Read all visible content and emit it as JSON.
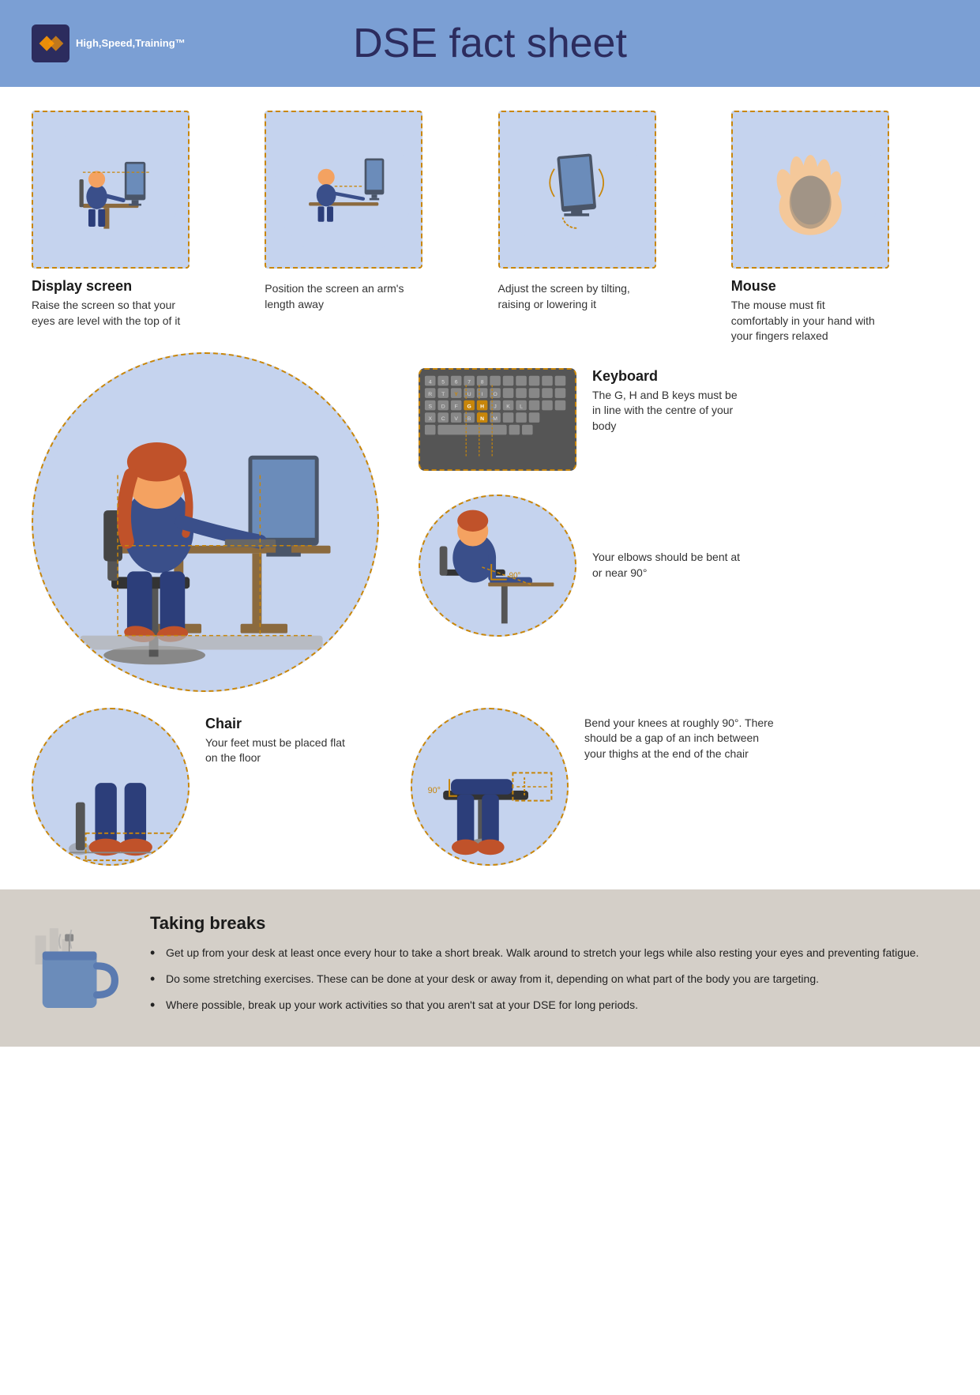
{
  "header": {
    "logo_lines": [
      "High",
      "Speed",
      "Training™"
    ],
    "title": "DSE fact sheet"
  },
  "display_screen": {
    "title": "Display screen",
    "desc": "Raise the screen so that your eyes are level with the top of it"
  },
  "position_screen": {
    "title": "",
    "desc": "Position the screen an arm's length away"
  },
  "adjust_screen": {
    "title": "",
    "desc": "Adjust the screen by tilting, raising or lowering it"
  },
  "mouse": {
    "title": "Mouse",
    "desc": "The mouse must fit comfortably in your hand with your fingers relaxed"
  },
  "keyboard": {
    "title": "Keyboard",
    "desc": "The G, H and B keys must be in line with the centre of your body"
  },
  "elbow": {
    "desc": "Your elbows should be bent at or near 90°"
  },
  "chair": {
    "title": "Chair",
    "desc": "Your feet must be placed flat on the floor"
  },
  "knee": {
    "desc": "Bend your knees at roughly 90°. There should be a gap of an inch between your thighs at the end of the chair"
  },
  "breaks": {
    "title": "Taking breaks",
    "items": [
      "Get up from your desk at least once every hour to take a short break. Walk around to stretch your legs while also resting your eyes and preventing fatigue.",
      "Do some stretching exercises. These can be done at your desk or away from it, depending on what part of the body you are targeting.",
      "Where possible, break up your work activities so that you aren't sat at your DSE for long periods."
    ]
  }
}
